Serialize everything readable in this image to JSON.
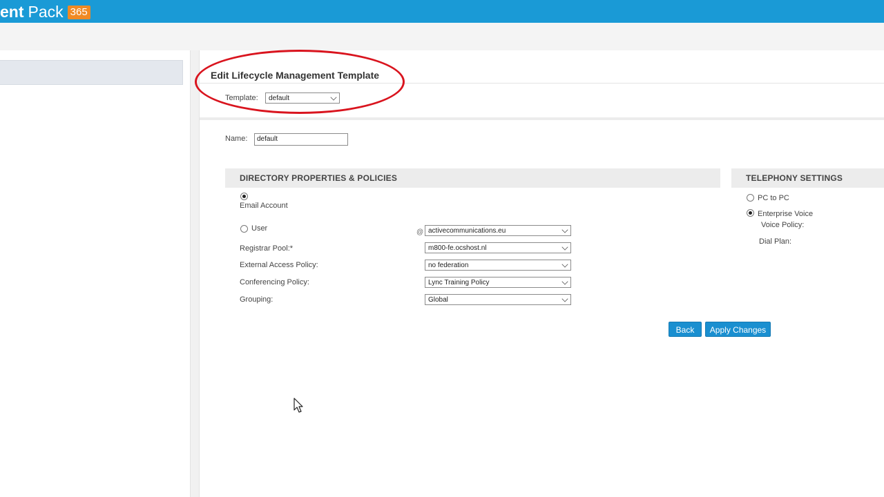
{
  "header": {
    "brand_bold": "ent",
    "brand_regular": "Pack",
    "brand_badge": "365"
  },
  "page": {
    "heading": "Edit Lifecycle Management Template",
    "template_label": "Template:",
    "template_value": "default",
    "name_label": "Name:",
    "name_value": "default"
  },
  "directory": {
    "header": "DIRECTORY PROPERTIES & POLICIES",
    "email_account_label": "Email Account",
    "email_account_selected": true,
    "user_label": "User",
    "user_selected": false,
    "domain_value": "activecommunications.eu",
    "registrar_pool_label": "Registrar Pool:*",
    "registrar_pool_value": "m800-fe.ocshost.nl",
    "external_access_label": "External Access Policy:",
    "external_access_value": "no federation",
    "conferencing_label": "Conferencing Policy:",
    "conferencing_value": "Lync Training Policy",
    "grouping_label": "Grouping:",
    "grouping_value": "Global"
  },
  "telephony": {
    "header": "TELEPHONY SETTINGS",
    "pc_to_pc_label": "PC to PC",
    "pc_to_pc_selected": false,
    "enterprise_voice_label": "Enterprise Voice",
    "enterprise_voice_selected": true,
    "voice_policy_label": "Voice Policy:",
    "dial_plan_label": "Dial Plan:"
  },
  "actions": {
    "back_label": "Back",
    "apply_label": "Apply Changes"
  },
  "colors": {
    "topbar": "#1a9ad6",
    "badge": "#f08a24",
    "button": "#1a8fd0",
    "highlight": "#d9141e"
  }
}
